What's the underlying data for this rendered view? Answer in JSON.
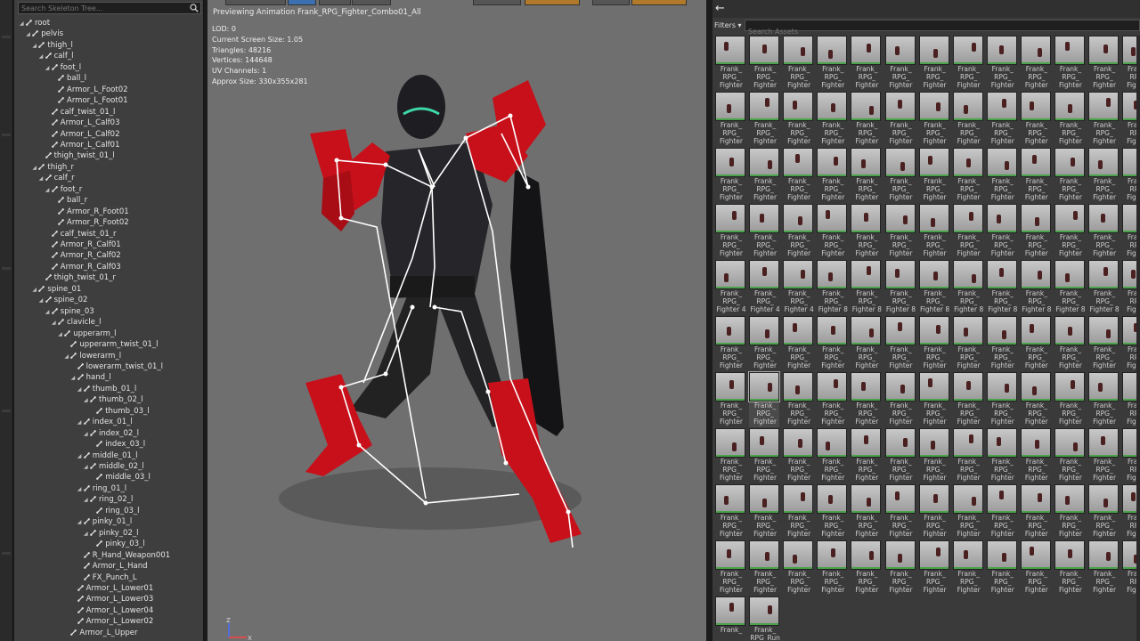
{
  "skeleton_tree": {
    "search_placeholder": "Search Skeleton Tree...",
    "nodes": [
      {
        "label": "root",
        "depth": 0
      },
      {
        "label": "pelvis",
        "depth": 1
      },
      {
        "label": "thigh_l",
        "depth": 2
      },
      {
        "label": "calf_l",
        "depth": 3
      },
      {
        "label": "foot_l",
        "depth": 4
      },
      {
        "label": "ball_l",
        "depth": 5
      },
      {
        "label": "Armor_L_Foot02",
        "depth": 5
      },
      {
        "label": "Armor_L_Foot01",
        "depth": 5
      },
      {
        "label": "calf_twist_01_l",
        "depth": 4
      },
      {
        "label": "Armor_L_Calf03",
        "depth": 4
      },
      {
        "label": "Armor_L_Calf02",
        "depth": 4
      },
      {
        "label": "Armor_L_Calf01",
        "depth": 4
      },
      {
        "label": "thigh_twist_01_l",
        "depth": 3
      },
      {
        "label": "thigh_r",
        "depth": 2
      },
      {
        "label": "calf_r",
        "depth": 3
      },
      {
        "label": "foot_r",
        "depth": 4
      },
      {
        "label": "ball_r",
        "depth": 5
      },
      {
        "label": "Armor_R_Foot01",
        "depth": 5
      },
      {
        "label": "Armor_R_Foot02",
        "depth": 5
      },
      {
        "label": "calf_twist_01_r",
        "depth": 4
      },
      {
        "label": "Armor_R_Calf01",
        "depth": 4
      },
      {
        "label": "Armor_R_Calf02",
        "depth": 4
      },
      {
        "label": "Armor_R_Calf03",
        "depth": 4
      },
      {
        "label": "thigh_twist_01_r",
        "depth": 3
      },
      {
        "label": "spine_01",
        "depth": 2
      },
      {
        "label": "spine_02",
        "depth": 3
      },
      {
        "label": "spine_03",
        "depth": 4
      },
      {
        "label": "clavicle_l",
        "depth": 5
      },
      {
        "label": "upperarm_l",
        "depth": 6
      },
      {
        "label": "upperarm_twist_01_l",
        "depth": 7
      },
      {
        "label": "lowerarm_l",
        "depth": 7
      },
      {
        "label": "lowerarm_twist_01_l",
        "depth": 8
      },
      {
        "label": "hand_l",
        "depth": 8
      },
      {
        "label": "thumb_01_l",
        "depth": 9
      },
      {
        "label": "thumb_02_l",
        "depth": 10
      },
      {
        "label": "thumb_03_l",
        "depth": 11
      },
      {
        "label": "index_01_l",
        "depth": 9
      },
      {
        "label": "index_02_l",
        "depth": 10
      },
      {
        "label": "index_03_l",
        "depth": 11
      },
      {
        "label": "middle_01_l",
        "depth": 9
      },
      {
        "label": "middle_02_l",
        "depth": 10
      },
      {
        "label": "middle_03_l",
        "depth": 11
      },
      {
        "label": "ring_01_l",
        "depth": 9
      },
      {
        "label": "ring_02_l",
        "depth": 10
      },
      {
        "label": "ring_03_l",
        "depth": 11
      },
      {
        "label": "pinky_01_l",
        "depth": 9
      },
      {
        "label": "pinky_02_l",
        "depth": 10
      },
      {
        "label": "pinky_03_l",
        "depth": 11
      },
      {
        "label": "R_Hand_Weapon001",
        "depth": 9
      },
      {
        "label": "Armor_L_Hand",
        "depth": 9
      },
      {
        "label": "FX_Punch_L",
        "depth": 9
      },
      {
        "label": "Armor_L_Lower01",
        "depth": 8
      },
      {
        "label": "Armor_L_Lower03",
        "depth": 8
      },
      {
        "label": "Armor_L_Lower04",
        "depth": 8
      },
      {
        "label": "Armor_L_Lower02",
        "depth": 8
      },
      {
        "label": "Armor_L_Upper",
        "depth": 7
      }
    ]
  },
  "viewport": {
    "title": "Previewing Animation Frank_RPG_Fighter_Combo01_All",
    "stats": [
      "LOD: 0",
      "Current Screen Size: 1.05",
      "Triangles: 48216",
      "Vertices: 144648",
      "UV Channels: 1",
      "Approx Size: 330x355x281"
    ],
    "gizmo": {
      "z": "Z",
      "x": "X"
    },
    "colors": {
      "background": "#6f6f6f",
      "armor": "#c8101a",
      "suit": "#1e1e22",
      "skeleton": "#ffffff",
      "visor": "#3fd8a8"
    }
  },
  "asset_browser": {
    "filters_label": "Filters ▾",
    "search_placeholder": "Search Assets",
    "back_icon": "arrow-left-icon",
    "rows": [
      [
        "Frank_\nRPG_\nFighter",
        "Frank_\nRPG_\nFighter",
        "Frank_\nRPG_\nFighter",
        "Frank_\nRPG_\nFighter",
        "Frank_\nRPG_\nFighter",
        "Frank_\nRPG_\nFighter",
        "Frank_\nRPG_\nFighter",
        "Frank_\nRPG_\nFighter",
        "Frank_\nRPG_\nFighter",
        "Frank_\nRPG_\nFighter",
        "Frank_\nRPG_\nFighter",
        "Frank_\nRPG_\nFighter",
        "Frank_\nRPG_\nFighter"
      ],
      [
        "Frank_\nRPG_\nFighter",
        "Frank_\nRPG_\nFighter",
        "Frank_\nRPG_\nFighter",
        "Frank_\nRPG_\nFighter",
        "Frank_\nRPG_\nFighter",
        "Frank_\nRPG_\nFighter",
        "Frank_\nRPG_\nFighter",
        "Frank_\nRPG_\nFighter",
        "Frank_\nRPG_\nFighter",
        "Frank_\nRPG_\nFighter",
        "Frank_\nRPG_\nFighter",
        "Frank_\nRPG_\nFighter",
        "Frank_\nRPG_\nFighter"
      ],
      [
        "Frank_\nRPG_\nFighter",
        "Frank_\nRPG_\nFighter",
        "Frank_\nRPG_\nFighter",
        "Frank_\nRPG_\nFighter",
        "Frank_\nRPG_\nFighter",
        "Frank_\nRPG_\nFighter",
        "Frank_\nRPG_\nFighter",
        "Frank_\nRPG_\nFighter",
        "Frank_\nRPG_\nFighter",
        "Frank_\nRPG_\nFighter",
        "Frank_\nRPG_\nFighter",
        "Frank_\nRPG_\nFighter",
        "Frank_\nRPG_\nFighter"
      ],
      [
        "Frank_\nRPG_\nFighter",
        "Frank_\nRPG_\nFighter",
        "Frank_\nRPG_\nFighter",
        "Frank_\nRPG_\nFighter",
        "Frank_\nRPG_\nFighter",
        "Frank_\nRPG_\nFighter",
        "Frank_\nRPG_\nFighter",
        "Frank_\nRPG_\nFighter",
        "Frank_\nRPG_\nFighter",
        "Frank_\nRPG_\nFighter",
        "Frank_\nRPG_\nFighter",
        "Frank_\nRPG_\nFighter",
        "Frank_\nRPG_\nFighter"
      ],
      [
        "Frank_\nRPG_\nFighter 4",
        "Frank_\nRPG_\nFighter 4",
        "Frank_\nRPG_\nFighter 4",
        "Frank_\nRPG_\nFighter 8",
        "Frank_\nRPG_\nFighter 8",
        "Frank_\nRPG_\nFighter 8",
        "Frank_\nRPG_\nFighter 8",
        "Frank_\nRPG_\nFighter 8",
        "Frank_\nRPG_\nFighter 8",
        "Frank_\nRPG_\nFighter 8",
        "Frank_\nRPG_\nFighter 8",
        "Frank_\nRPG_\nFighter 8",
        "Frank_\nRPG_\nFighter"
      ],
      [
        "Frank_\nRPG_\nFighter",
        "Frank_\nRPG_\nFighter",
        "Frank_\nRPG_\nFighter",
        "Frank_\nRPG_\nFighter",
        "Frank_\nRPG_\nFighter",
        "Frank_\nRPG_\nFighter",
        "Frank_\nRPG_\nFighter",
        "Frank_\nRPG_\nFighter",
        "Frank_\nRPG_\nFighter",
        "Frank_\nRPG_\nFighter",
        "Frank_\nRPG_\nFighter",
        "Frank_\nRPG_\nFighter",
        "Frank_\nRPG_\nFighter"
      ],
      [
        "Frank_\nRPG_\nFighter",
        "Frank_\nRPG_\nFighter",
        "Frank_\nRPG_\nFighter",
        "Frank_\nRPG_\nFighter",
        "Frank_\nRPG_\nFighter",
        "Frank_\nRPG_\nFighter",
        "Frank_\nRPG_\nFighter",
        "Frank_\nRPG_\nFighter",
        "Frank_\nRPG_\nFighter",
        "Frank_\nRPG_\nFighter",
        "Frank_\nRPG_\nFighter",
        "Frank_\nRPG_\nFighter",
        "Frank_\nRPG_\nFighter"
      ],
      [
        "Frank_\nRPG_\nFighter",
        "Frank_\nRPG_\nFighter",
        "Frank_\nRPG_\nFighter",
        "Frank_\nRPG_\nFighter",
        "Frank_\nRPG_\nFighter",
        "Frank_\nRPG_\nFighter",
        "Frank_\nRPG_\nFighter",
        "Frank_\nRPG_\nFighter",
        "Frank_\nRPG_\nFighter",
        "Frank_\nRPG_\nFighter",
        "Frank_\nRPG_\nFighter",
        "Frank_\nRPG_\nFighter",
        "Frank_\nRPG_\nFighter"
      ],
      [
        "Frank_\nRPG_\nFighter",
        "Frank_\nRPG_\nFighter",
        "Frank_\nRPG_\nFighter",
        "Frank_\nRPG_\nFighter",
        "Frank_\nRPG_\nFighter",
        "Frank_\nRPG_\nFighter",
        "Frank_\nRPG_\nFighter",
        "Frank_\nRPG_\nFighter",
        "Frank_\nRPG_\nFighter",
        "Frank_\nRPG_\nFighter",
        "Frank_\nRPG_\nFighter",
        "Frank_\nRPG_\nFighter",
        "Frank_\nRPG_\nFighter"
      ],
      [
        "Frank_\nRPG_\nFighter",
        "Frank_\nRPG_\nFighter",
        "Frank_\nRPG_\nFighter",
        "Frank_\nRPG_\nFighter",
        "Frank_\nRPG_\nFighter",
        "Frank_\nRPG_\nFighter",
        "Frank_\nRPG_\nFighter",
        "Frank_\nRPG_\nFighter",
        "Frank_\nRPG_\nFighter",
        "Frank_\nRPG_\nFighter",
        "Frank_\nRPG_\nFighter",
        "Frank_\nRPG_\nFighter",
        "Frank_\nRPG_\nFighter"
      ],
      [
        "Frank_",
        "Frank_\nRPG_Run"
      ]
    ],
    "selected_row": 6,
    "selected_col": 1
  }
}
